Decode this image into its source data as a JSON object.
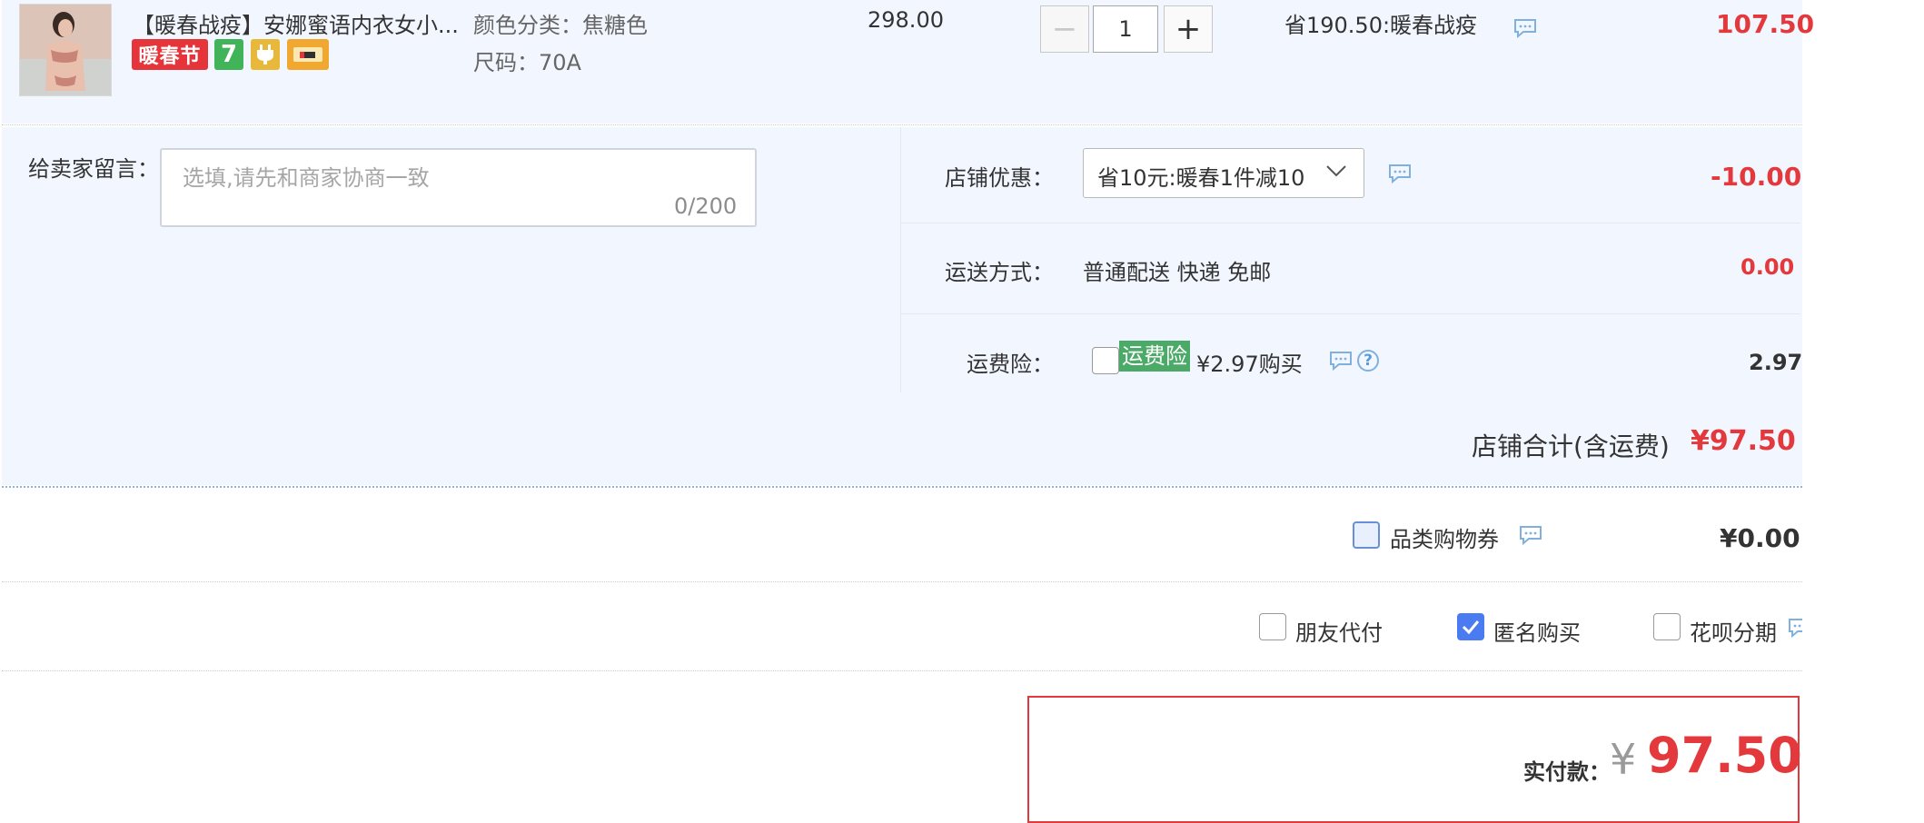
{
  "item": {
    "title": "【暖春战疫】安娜蜜语内衣女小...",
    "badges": {
      "festival": "暖春节",
      "seven_day": "7"
    },
    "props": {
      "color": "颜色分类：焦糖色",
      "size": "尺码：70A"
    },
    "unit_price": "298.00",
    "quantity": "1",
    "qty_minus": "−",
    "qty_plus": "+",
    "promo": "省190.50:暖春战疫",
    "subtotal": "107.50"
  },
  "message": {
    "label": "给卖家留言：",
    "placeholder": "选填,请先和商家协商一致",
    "counter": "0/200"
  },
  "shop_discount": {
    "label": "店铺优惠：",
    "selected": "省10元:暖春1件减10",
    "amount": "-10.00"
  },
  "shipping": {
    "label": "运送方式：",
    "method": "普通配送 快递 免邮",
    "amount": "0.00"
  },
  "insurance": {
    "label": "运费险：",
    "tag": "运费险",
    "price": "¥2.97购买",
    "help": "?",
    "amount": "2.97",
    "checked": false
  },
  "shop_total": {
    "label": "店铺合计(含运费)",
    "value": "¥97.50"
  },
  "coupon": {
    "label": "品类购物券",
    "value": "¥0.00"
  },
  "options": [
    {
      "label": "朋友代付",
      "checked": false
    },
    {
      "label": "匿名购买",
      "checked": true
    },
    {
      "label": "花呗分期",
      "checked": false
    }
  ],
  "payment": {
    "label": "实付款：",
    "currency": "¥",
    "value": "97.50"
  },
  "colors": {
    "accent_red": "#e4393c",
    "panel_bg": "#f2f7ff",
    "insurance_green": "#4caa68",
    "checkbox_blue": "#4a7bf0"
  }
}
